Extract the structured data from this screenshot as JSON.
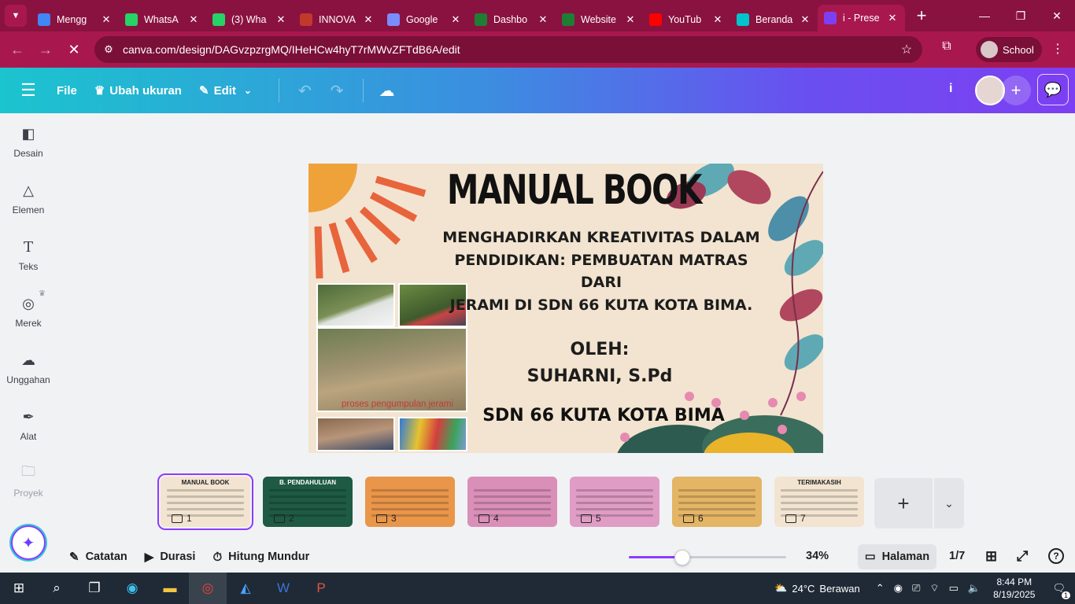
{
  "browser": {
    "tabs": [
      {
        "title": "Mengg",
        "favicon": "blue-doc-icon",
        "color": "#4285f4"
      },
      {
        "title": "WhatsA",
        "favicon": "whatsapp-icon",
        "color": "#25d366"
      },
      {
        "title": "(3) Wha",
        "favicon": "whatsapp-icon",
        "color": "#25d366"
      },
      {
        "title": "INNOVA",
        "favicon": "school-logo-icon",
        "color": "#c0392b"
      },
      {
        "title": "Google",
        "favicon": "gemini-icon",
        "color": "#7b8cff"
      },
      {
        "title": "Dashbo",
        "favicon": "green-shield-icon",
        "color": "#1e7e34"
      },
      {
        "title": "Website",
        "favicon": "green-shield-icon",
        "color": "#1e7e34"
      },
      {
        "title": "YouTub",
        "favicon": "youtube-icon",
        "color": "#ff0000"
      },
      {
        "title": "Beranda",
        "favicon": "canva-icon",
        "color": "#00c4cc"
      },
      {
        "title": "i - Prese",
        "favicon": "canva-active-icon",
        "color": "#7d3ff2"
      }
    ],
    "url": "canva.com/design/DAGvzpzrgMQ/IHeHCw4hyT7rMWvZFTdB6A/edit",
    "profile_label": "School"
  },
  "canva_header": {
    "file_label": "File",
    "resize_label": "Ubah ukuran",
    "edit_label": "Edit",
    "info_label": "i"
  },
  "sidebar": {
    "items": [
      {
        "label": "Desain",
        "icon": "layout-icon"
      },
      {
        "label": "Elemen",
        "icon": "shapes-icon"
      },
      {
        "label": "Teks",
        "icon": "text-icon"
      },
      {
        "label": "Merek",
        "icon": "brand-icon"
      },
      {
        "label": "Unggahan",
        "icon": "upload-cloud-icon"
      },
      {
        "label": "Alat",
        "icon": "pen-tool-icon"
      },
      {
        "label": "Proyek",
        "icon": "folder-icon"
      }
    ]
  },
  "slide": {
    "title": "MANUAL BOOK",
    "subtitle_lines": [
      "MENGHADIRKAN KREATIVITAS DALAM",
      "PENDIDIKAN: PEMBUATAN MATRAS DARI",
      "JERAMI DI SDN 66 KUTA KOTA BIMA."
    ],
    "by_label": "OLEH:",
    "author": "SUHARNI, S.Pd",
    "school": "SDN 66 KUTA KOTA BIMA",
    "photo_caption": "proses pengumpulan jerami"
  },
  "thumbnails": [
    {
      "num": "1",
      "title": "MANUAL BOOK",
      "bg": "#f2e4d0"
    },
    {
      "num": "2",
      "title": "B. PENDAHULUAN",
      "bg": "#1e5a44"
    },
    {
      "num": "3",
      "title": "",
      "bg": "#e9954a"
    },
    {
      "num": "4",
      "title": "",
      "bg": "#d98fb8"
    },
    {
      "num": "5",
      "title": "",
      "bg": "#df9cc4"
    },
    {
      "num": "6",
      "title": "",
      "bg": "#e3b565"
    },
    {
      "num": "7",
      "title": "TERIMAKASIH",
      "bg": "#f2e4d0"
    }
  ],
  "bottom_bar": {
    "notes_label": "Catatan",
    "duration_label": "Durasi",
    "timer_label": "Hitung Mundur",
    "zoom_fraction": 0.34,
    "zoom_value": "34%",
    "pages_label": "Halaman",
    "page_count": "1/7"
  },
  "taskbar": {
    "temperature": "24°C",
    "weather": "Berawan",
    "time": "8:44 PM",
    "date": "8/19/2025",
    "notifications": "1"
  },
  "colors": {
    "chrome_tabbar": "#8a1240",
    "chrome_toolbar": "#a8184f",
    "canva_accent": "#8b3dff"
  }
}
